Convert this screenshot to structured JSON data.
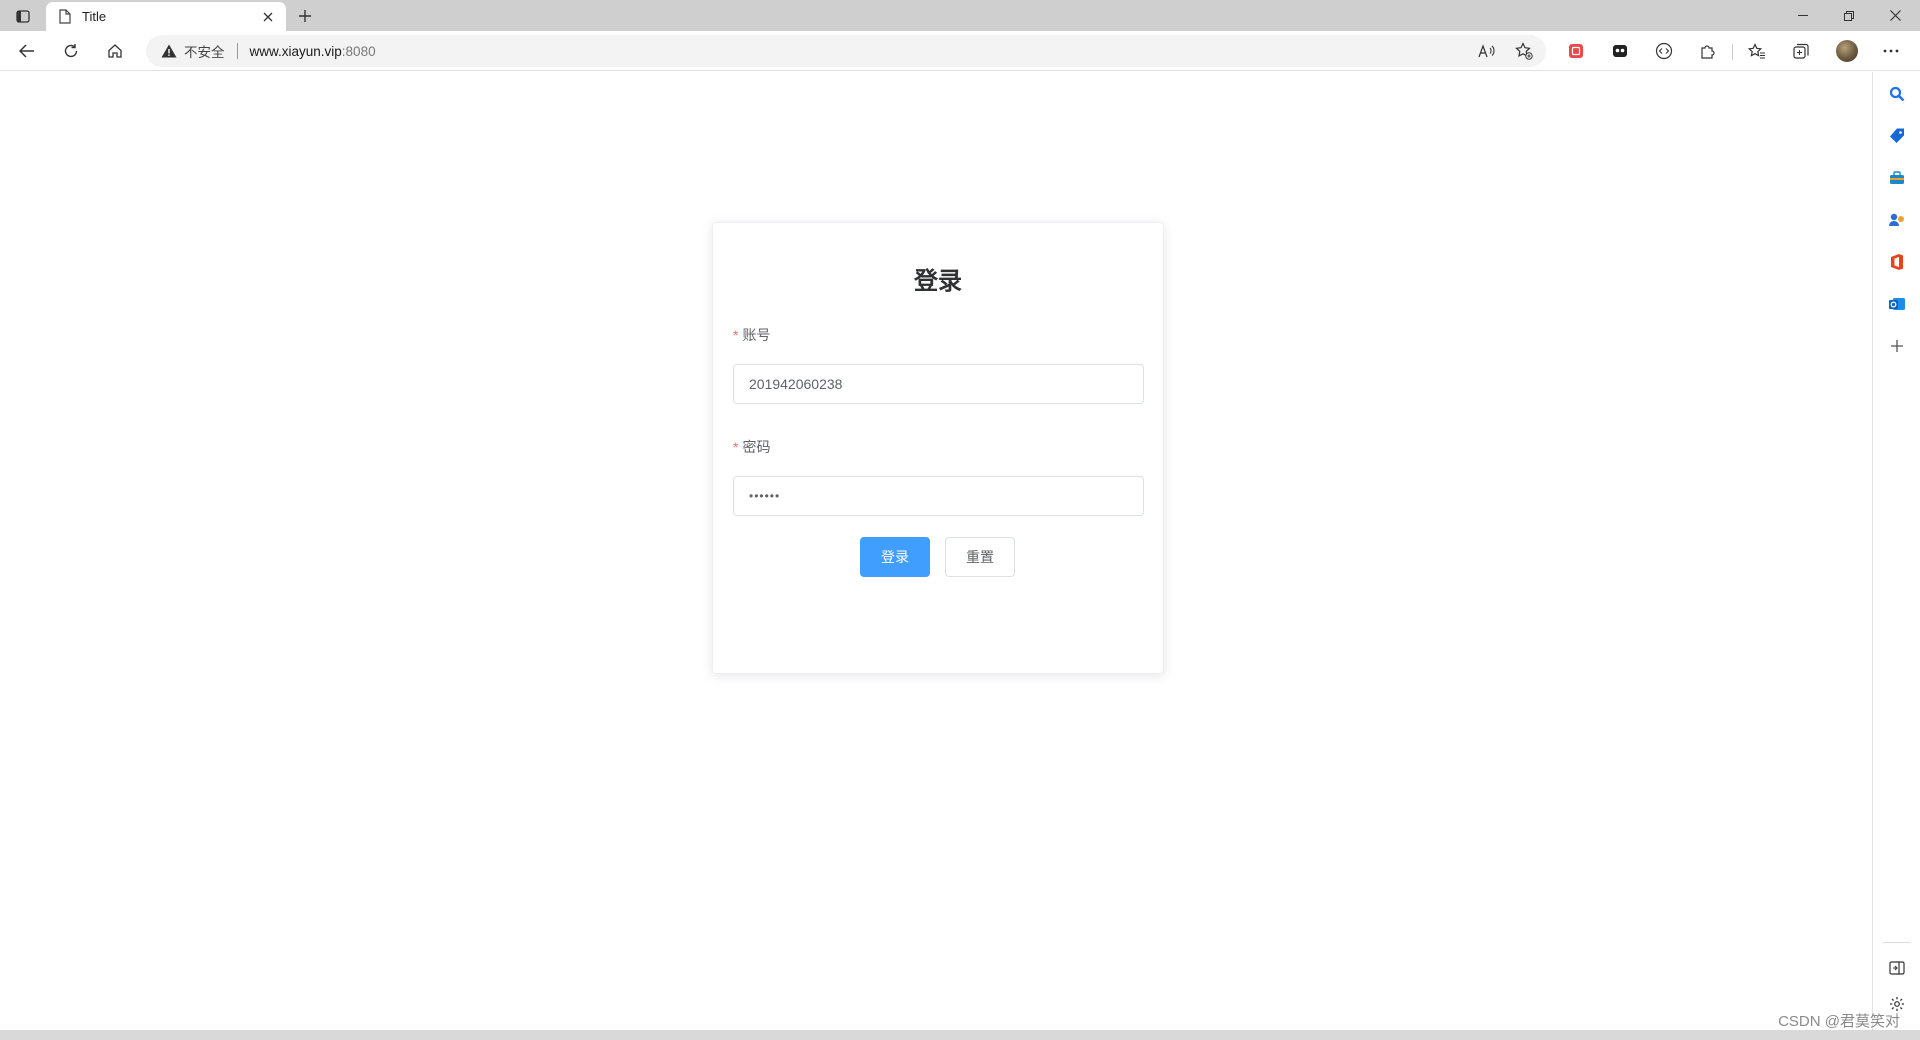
{
  "browser": {
    "tab": {
      "title": "Title"
    },
    "address": {
      "insecure_label": "不安全",
      "host": "www.xiayun.vip",
      "port": ":8080"
    }
  },
  "login": {
    "title": "登录",
    "account": {
      "label": "账号",
      "required_mark": "*",
      "value": "201942060238"
    },
    "password": {
      "label": "密码",
      "required_mark": "*",
      "value": "••••••"
    },
    "submit_label": "登录",
    "reset_label": "重置"
  },
  "sidebar": {
    "icons": [
      "search-icon",
      "shopping-tag-icon",
      "tools-icon",
      "games-icon",
      "office-icon",
      "outlook-icon",
      "add-icon"
    ]
  },
  "watermark": "CSDN @君莫笑对",
  "colors": {
    "primary": "#409eff",
    "required": "#f56c6c",
    "tabstrip": "#cfcfcf"
  }
}
